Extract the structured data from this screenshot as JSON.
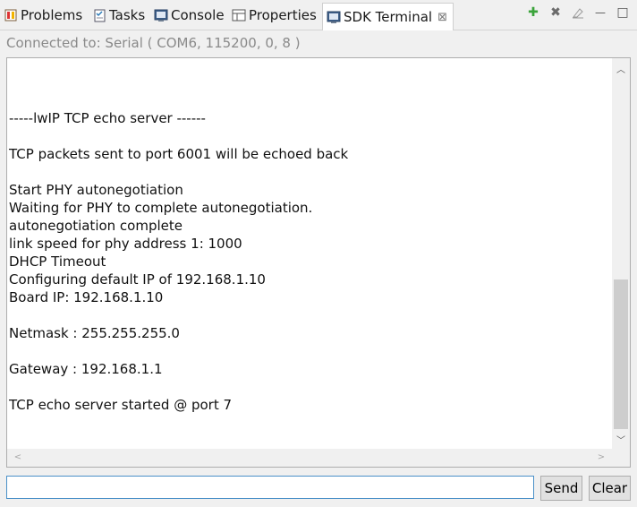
{
  "tabs": [
    {
      "label": "Problems",
      "icon": "problems-icon"
    },
    {
      "label": "Tasks",
      "icon": "tasks-icon"
    },
    {
      "label": "Console",
      "icon": "console-icon"
    },
    {
      "label": "Properties",
      "icon": "properties-icon"
    },
    {
      "label": "SDK Terminal",
      "icon": "terminal-icon",
      "active": true,
      "close": "⊠"
    }
  ],
  "toolbar": {
    "add": "✚",
    "remove": "✖",
    "clear": "⌫",
    "minimize": "—",
    "maximize": "□"
  },
  "connection": {
    "text": "Connected to: Serial (  COM6, 115200, 0, 8 )"
  },
  "terminal": {
    "lines": [
      "-----lwIP TCP echo server ------",
      "",
      "TCP packets sent to port 6001 will be echoed back",
      "",
      "Start PHY autonegotiation",
      "Waiting for PHY to complete autonegotiation.",
      "autonegotiation complete",
      "link speed for phy address 1: 1000",
      "DHCP Timeout",
      "Configuring default IP of 192.168.1.10",
      "Board IP: 192.168.1.10",
      "",
      "Netmask : 255.255.255.0",
      "",
      "Gateway : 192.168.1.1",
      "",
      "TCP echo server started @ port 7"
    ]
  },
  "input": {
    "value": "",
    "placeholder": ""
  },
  "buttons": {
    "send": "Send",
    "clear": "Clear"
  },
  "colors": {
    "add_green": "#3aa33a",
    "remove_gray": "#6b6b6b",
    "input_border": "#4a90c8"
  }
}
